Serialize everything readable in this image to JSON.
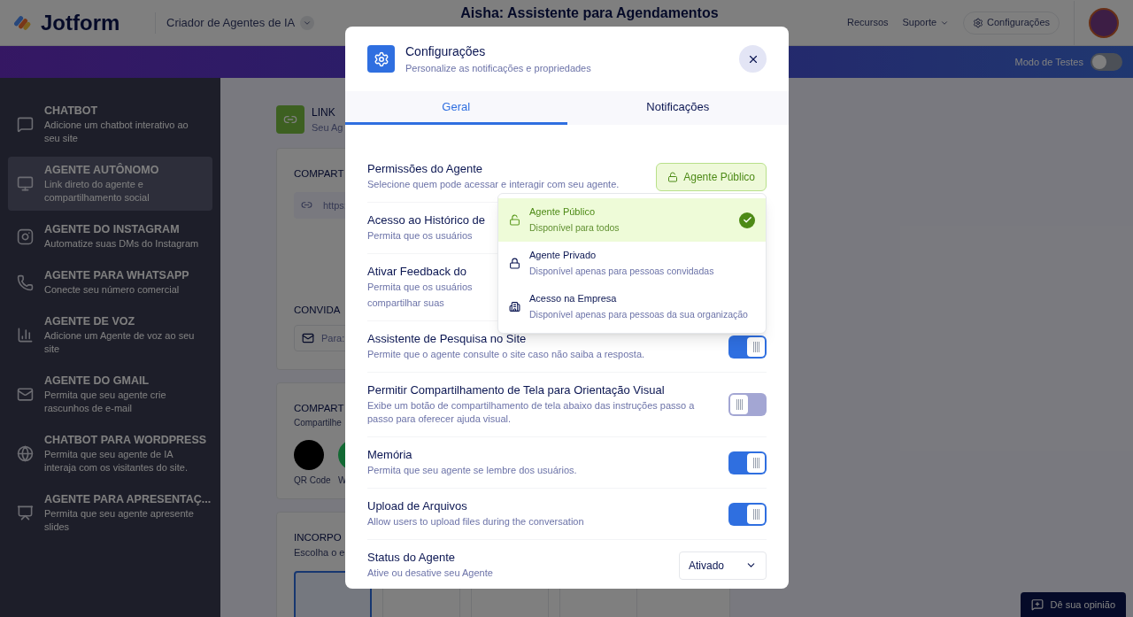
{
  "header": {
    "logo": "Jotform",
    "product": "Criador de Agentes de IA",
    "title": "Aisha: Assistente para Agendamentos",
    "links": [
      {
        "label": "Recursos",
        "kind": "plain"
      },
      {
        "label": "Suporte",
        "kind": "menu"
      }
    ],
    "settings_button": "Configurações"
  },
  "banner": {
    "test_mode_label": "Modo de Testes",
    "test_mode_on": false
  },
  "sidebar": {
    "items": [
      {
        "title": "CHATBOT",
        "description": "Adicione um chatbot interativo ao seu site",
        "selected": false
      },
      {
        "title": "AGENTE AUTÔNOMO",
        "description": "Link direto do agente e compartilhamento social",
        "selected": true
      },
      {
        "title": "AGENTE DO INSTAGRAM",
        "description": "Automatize suas DMs do Instagram",
        "selected": false
      },
      {
        "title": "AGENTE PARA WHATSAPP",
        "description": "Conecte seu número comercial",
        "selected": false
      },
      {
        "title": "AGENTE DE VOZ",
        "description": "Adicione um Agente de voz ao seu site",
        "selected": false
      },
      {
        "title": "AGENTE DO GMAIL",
        "description": "Permita que seu agente crie rascunhos de e-mail",
        "selected": false
      },
      {
        "title": "CHATBOT PARA WORDPRESS",
        "description": "Permita que seu agente de IA interaja com os visitantes do site.",
        "selected": false
      },
      {
        "title": "AGENTE PARA APRESENTAÇ...",
        "description": "Permita que seu agente apresente slides",
        "selected": false
      }
    ]
  },
  "main": {
    "link_card": {
      "title": "LINK",
      "subtitle": "Seu Ag"
    },
    "share_card": {
      "heading": "COMPART",
      "url": "https:",
      "invite_heading": "CONVIDA",
      "invite_placeholder": "Para:"
    },
    "social_card": {
      "heading": "COMPART",
      "subtitle": "Compartilhe",
      "channels": [
        {
          "label": "QR Code",
          "kind": "qr"
        },
        {
          "label": "W",
          "kind": "whatsapp"
        }
      ]
    },
    "embed_card": {
      "heading": "INCORPO",
      "subtitle": "Escolha o e"
    }
  },
  "dialog": {
    "title": "Configurações",
    "subtitle": "Personalize as notificações e propriedades",
    "tabs": [
      {
        "label": "Geral",
        "selected": true
      },
      {
        "label": "Notificações",
        "selected": false
      }
    ],
    "rows": [
      {
        "kind": "permission",
        "title": "Permissões do Agente",
        "description": [
          "Selecione quem pode acessar e interagir com seu agente."
        ],
        "value": "Agente Público"
      },
      {
        "kind": "covered",
        "title": "Acesso ao Histórico de",
        "description": [
          "Permita que os usuários"
        ]
      },
      {
        "kind": "covered",
        "title": "Ativar Feedback do",
        "description": [
          "Permita que os usuários",
          "compartilhar suas"
        ]
      },
      {
        "kind": "toggle",
        "title": "Assistente de Pesquisa no Site",
        "description": [
          "Permite que o agente consulte o site caso não saiba a resposta."
        ],
        "on": true
      },
      {
        "kind": "toggle",
        "title": "Permitir Compartilhamento de Tela para Orientação Visual",
        "description": [
          "Exibe um botão de compartilhamento de tela abaixo das instruções passo a passo para oferecer ajuda visual."
        ],
        "on": false
      },
      {
        "kind": "toggle",
        "title": "Memória",
        "description": [
          "Permita que seu agente se lembre dos usuários."
        ],
        "on": true
      },
      {
        "kind": "toggle",
        "title": "Upload de Arquivos",
        "description": [
          "Allow users to upload files during the conversation"
        ],
        "on": true
      },
      {
        "kind": "select",
        "title": "Status do Agente",
        "description": [
          "Ative ou desative seu Agente"
        ],
        "value": "Ativado"
      }
    ],
    "permission_menu": [
      {
        "title": "Agente Público",
        "description": "Disponível para todos",
        "selected": true
      },
      {
        "title": "Agente Privado",
        "description": "Disponível apenas para pessoas convidadas",
        "selected": false
      },
      {
        "title": "Acesso na Empresa",
        "description": "Disponível apenas para pessoas da sua organização",
        "selected": false
      }
    ]
  },
  "feedback_button": "Dê sua opinião"
}
